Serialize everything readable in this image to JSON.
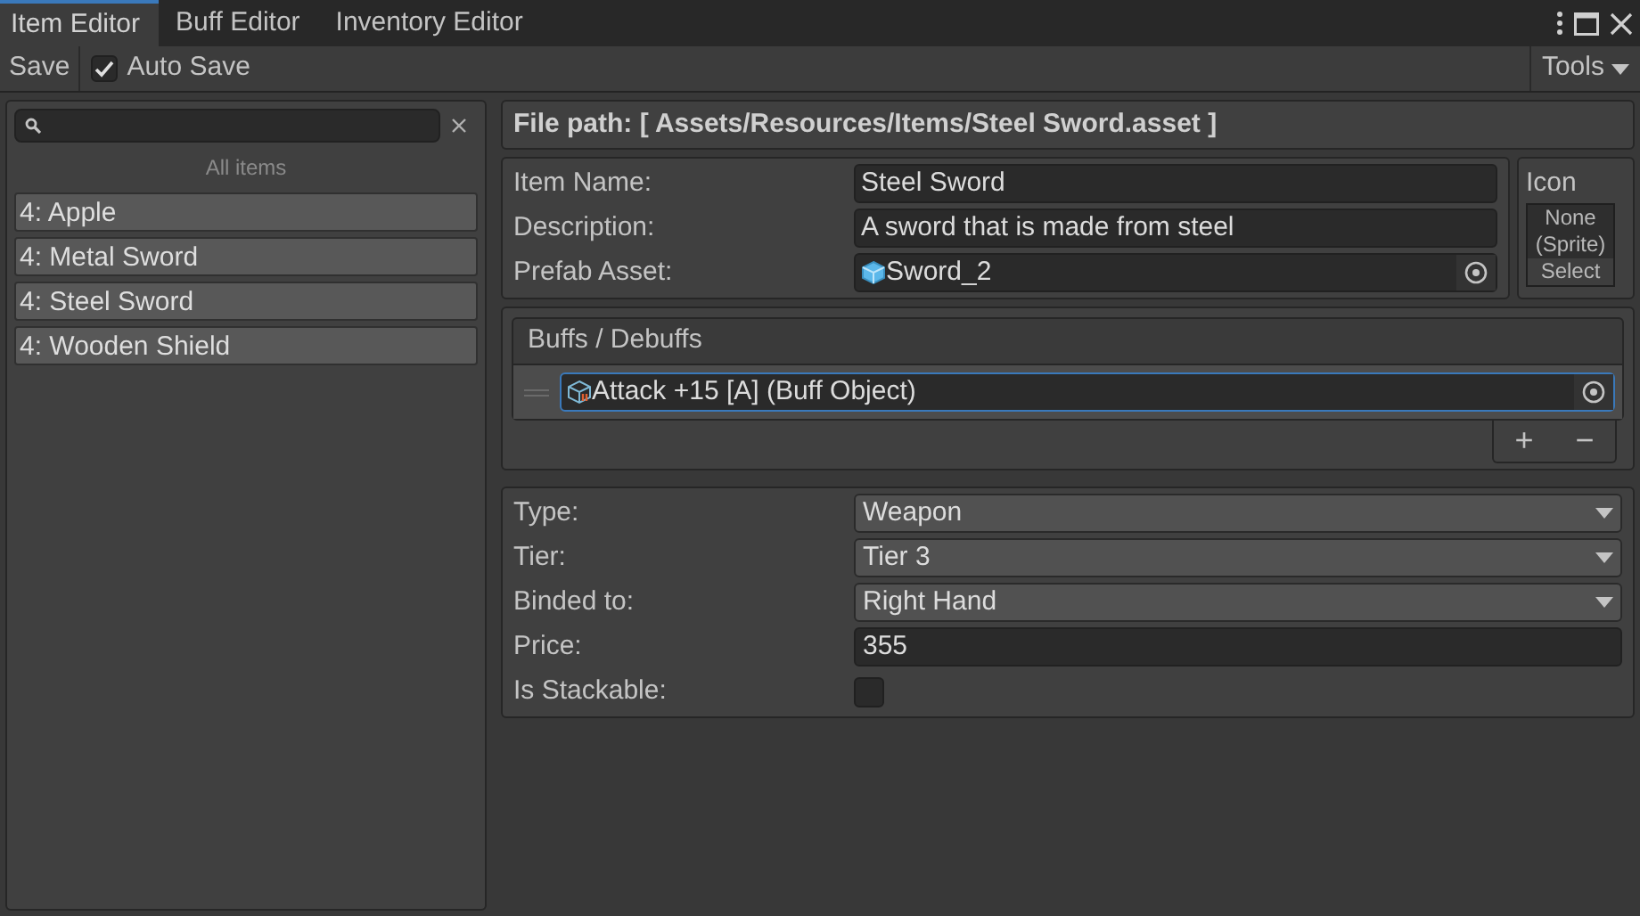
{
  "tabs": [
    {
      "label": "Item Editor",
      "selected": true
    },
    {
      "label": "Buff Editor",
      "selected": false
    },
    {
      "label": "Inventory Editor",
      "selected": false
    }
  ],
  "toolbar": {
    "save": "Save",
    "auto_save": {
      "label": "Auto Save",
      "checked": true
    },
    "tools": "Tools"
  },
  "sidebar": {
    "heading": "All items",
    "items": [
      {
        "label": "4: Apple",
        "selected": false
      },
      {
        "label": "4: Metal Sword",
        "selected": false
      },
      {
        "label": "4: Steel Sword",
        "selected": false
      },
      {
        "label": "4: Wooden Shield",
        "selected": false
      }
    ]
  },
  "file_path": "File path: [ Assets/Resources/Items/Steel Sword.asset ]",
  "item_fields": [
    {
      "label": "Item Name:",
      "value": "Steel Sword",
      "kind": "text"
    },
    {
      "label": "Description:",
      "value": "A sword that is made from steel",
      "kind": "text"
    },
    {
      "label": "Prefab Asset:",
      "value": "Sword_2",
      "kind": "object"
    }
  ],
  "icon": {
    "title": "Icon",
    "value_line_1": "None",
    "value_line_2": "(Sprite)",
    "select": "Select"
  },
  "buffs": {
    "title": "Buffs / Debuffs",
    "entries": [
      {
        "value": "Attack +15 [A] (Buff Object)",
        "selected": true
      }
    ],
    "add": "+",
    "remove": "−"
  },
  "properties": [
    {
      "label": "Type:",
      "kind": "dropdown",
      "value": "Weapon"
    },
    {
      "label": "Tier:",
      "kind": "dropdown",
      "value": "Tier 3"
    },
    {
      "label": "Binded to:",
      "kind": "dropdown",
      "value": "Right Hand"
    },
    {
      "label": "Price:",
      "kind": "text",
      "value": "355"
    },
    {
      "label": "Is Stackable:",
      "kind": "checkbox",
      "checked": false
    }
  ]
}
